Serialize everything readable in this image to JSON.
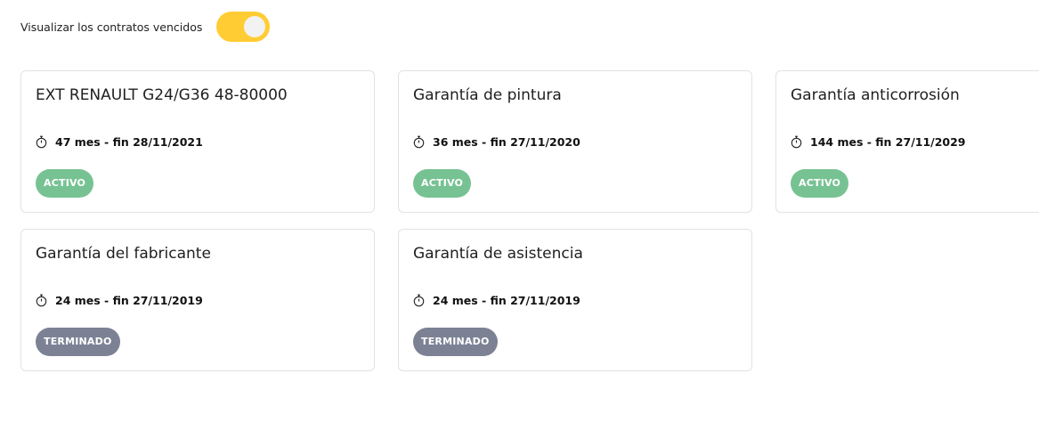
{
  "filter": {
    "label": "Visualizar los contratos vencidos",
    "enabled": true
  },
  "contracts": [
    {
      "title": "EXT RENAULT G24/G36 48-80000",
      "duration": "47 mes - fin 28/11/2021",
      "status": "ACTIVO"
    },
    {
      "title": "Garantía de pintura",
      "duration": "36 mes - fin 27/11/2020",
      "status": "ACTIVO"
    },
    {
      "title": "Garantía anticorrosión",
      "duration": "144 mes - fin 27/11/2029",
      "status": "ACTIVO"
    },
    {
      "title": "Garantía del fabricante",
      "duration": "24 mes - fin 27/11/2019",
      "status": "TERMINADO"
    },
    {
      "title": "Garantía de asistencia",
      "duration": "24 mes - fin 27/11/2019",
      "status": "TERMINADO"
    }
  ],
  "colors": {
    "toggle": "#ffcc33",
    "active_badge": "#77c293",
    "ended_badge": "#7c8294"
  },
  "icons": {
    "duration": "stopwatch-icon"
  }
}
